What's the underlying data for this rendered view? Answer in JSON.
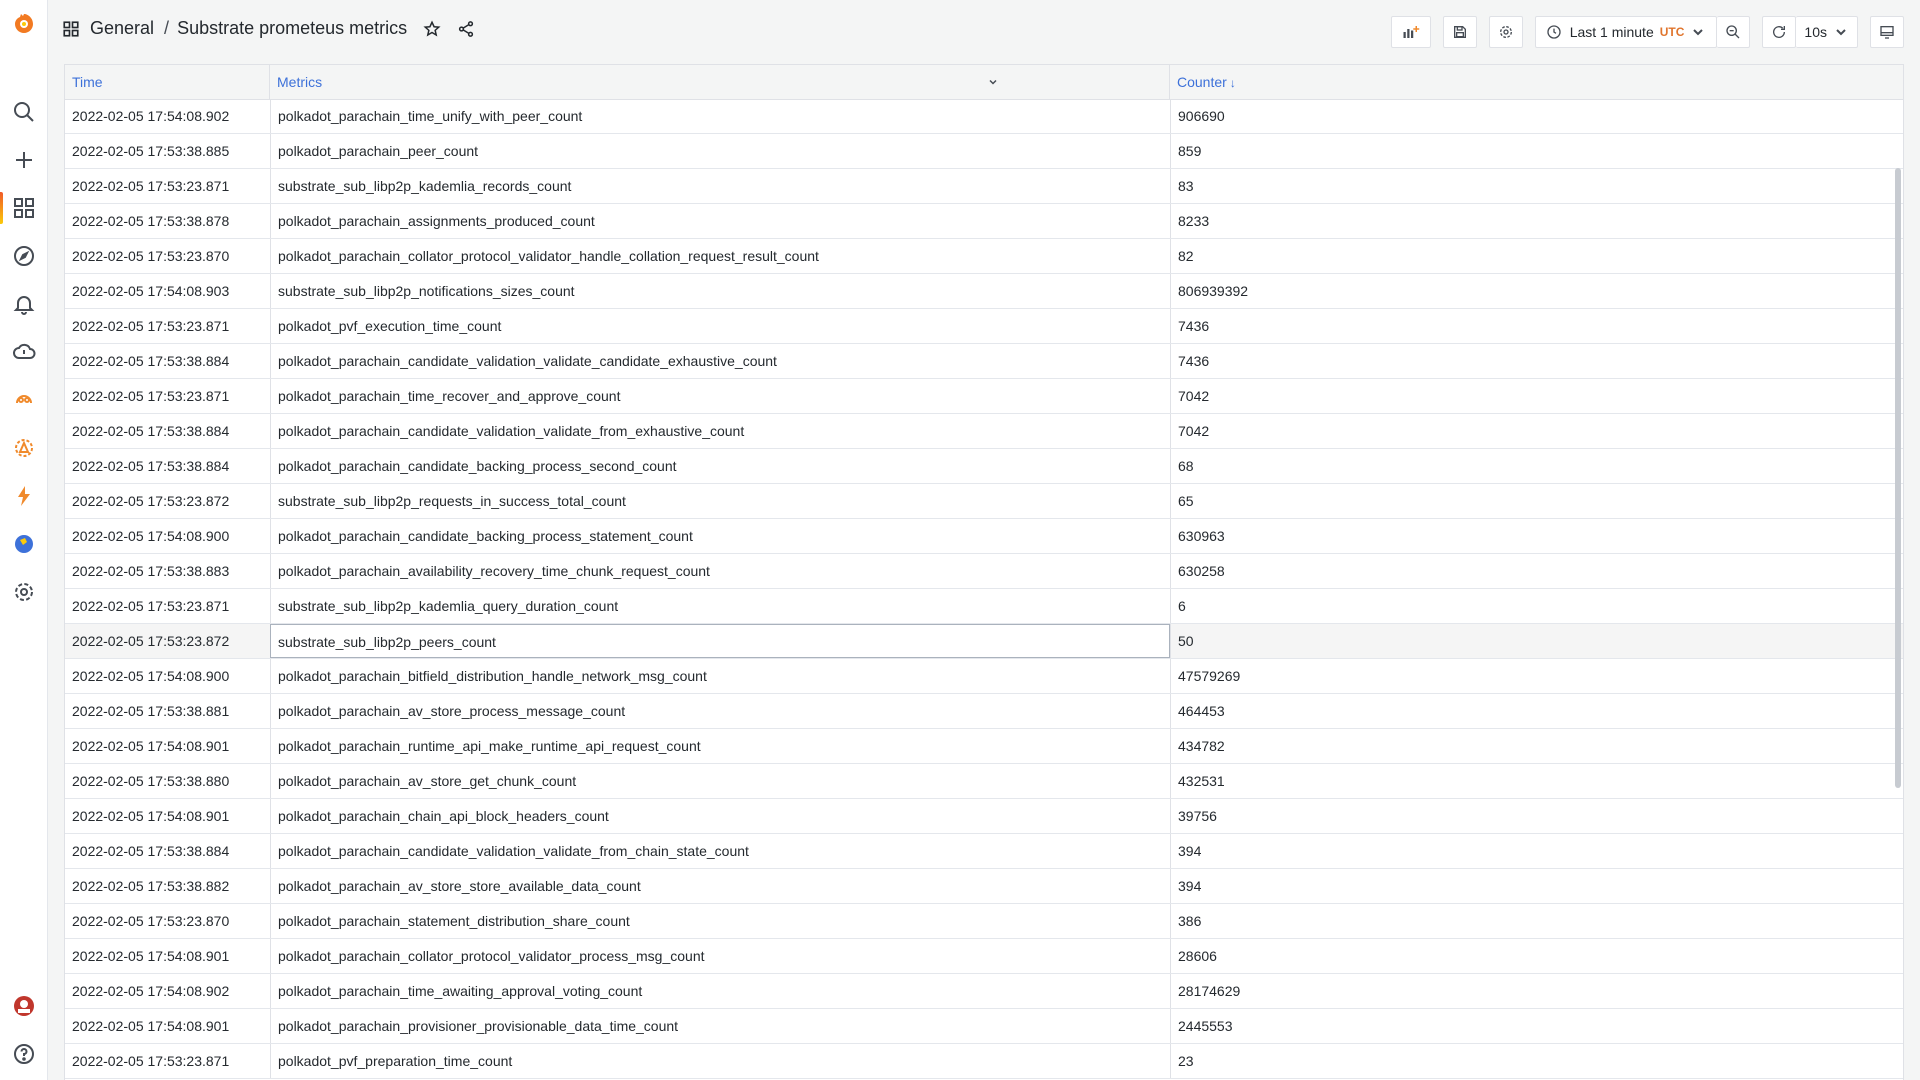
{
  "breadcrumb": {
    "folder": "General",
    "separator": "/",
    "title": "Substrate prometeus metrics"
  },
  "toolbar": {
    "time_range": "Last 1 minute",
    "timezone": "UTC",
    "refresh_interval": "10s"
  },
  "table": {
    "columns": [
      "Time",
      "Metrics",
      "Counter"
    ],
    "sort_column": "Counter",
    "sort_direction": "↓",
    "rows": [
      {
        "time": "2022-02-05 17:54:08.902",
        "metric": "polkadot_parachain_time_unify_with_peer_count",
        "counter": "906690"
      },
      {
        "time": "2022-02-05 17:53:38.885",
        "metric": "polkadot_parachain_peer_count",
        "counter": "859"
      },
      {
        "time": "2022-02-05 17:53:23.871",
        "metric": "substrate_sub_libp2p_kademlia_records_count",
        "counter": "83"
      },
      {
        "time": "2022-02-05 17:53:38.878",
        "metric": "polkadot_parachain_assignments_produced_count",
        "counter": "8233"
      },
      {
        "time": "2022-02-05 17:53:23.870",
        "metric": "polkadot_parachain_collator_protocol_validator_handle_collation_request_result_count",
        "counter": "82"
      },
      {
        "time": "2022-02-05 17:54:08.903",
        "metric": "substrate_sub_libp2p_notifications_sizes_count",
        "counter": "806939392"
      },
      {
        "time": "2022-02-05 17:53:23.871",
        "metric": "polkadot_pvf_execution_time_count",
        "counter": "7436"
      },
      {
        "time": "2022-02-05 17:53:38.884",
        "metric": "polkadot_parachain_candidate_validation_validate_candidate_exhaustive_count",
        "counter": "7436"
      },
      {
        "time": "2022-02-05 17:53:23.871",
        "metric": "polkadot_parachain_time_recover_and_approve_count",
        "counter": "7042"
      },
      {
        "time": "2022-02-05 17:53:38.884",
        "metric": "polkadot_parachain_candidate_validation_validate_from_exhaustive_count",
        "counter": "7042"
      },
      {
        "time": "2022-02-05 17:53:38.884",
        "metric": "polkadot_parachain_candidate_backing_process_second_count",
        "counter": "68"
      },
      {
        "time": "2022-02-05 17:53:23.872",
        "metric": "substrate_sub_libp2p_requests_in_success_total_count",
        "counter": "65"
      },
      {
        "time": "2022-02-05 17:54:08.900",
        "metric": "polkadot_parachain_candidate_backing_process_statement_count",
        "counter": "630963"
      },
      {
        "time": "2022-02-05 17:53:38.883",
        "metric": "polkadot_parachain_availability_recovery_time_chunk_request_count",
        "counter": "630258"
      },
      {
        "time": "2022-02-05 17:53:23.871",
        "metric": "substrate_sub_libp2p_kademlia_query_duration_count",
        "counter": "6"
      },
      {
        "time": "2022-02-05 17:53:23.872",
        "metric": "substrate_sub_libp2p_peers_count",
        "counter": "50"
      },
      {
        "time": "2022-02-05 17:54:08.900",
        "metric": "polkadot_parachain_bitfield_distribution_handle_network_msg_count",
        "counter": "47579269"
      },
      {
        "time": "2022-02-05 17:53:38.881",
        "metric": "polkadot_parachain_av_store_process_message_count",
        "counter": "464453"
      },
      {
        "time": "2022-02-05 17:54:08.901",
        "metric": "polkadot_parachain_runtime_api_make_runtime_api_request_count",
        "counter": "434782"
      },
      {
        "time": "2022-02-05 17:53:38.880",
        "metric": "polkadot_parachain_av_store_get_chunk_count",
        "counter": "432531"
      },
      {
        "time": "2022-02-05 17:54:08.901",
        "metric": "polkadot_parachain_chain_api_block_headers_count",
        "counter": "39756"
      },
      {
        "time": "2022-02-05 17:53:38.884",
        "metric": "polkadot_parachain_candidate_validation_validate_from_chain_state_count",
        "counter": "394"
      },
      {
        "time": "2022-02-05 17:53:38.882",
        "metric": "polkadot_parachain_av_store_store_available_data_count",
        "counter": "394"
      },
      {
        "time": "2022-02-05 17:53:23.870",
        "metric": "polkadot_parachain_statement_distribution_share_count",
        "counter": "386"
      },
      {
        "time": "2022-02-05 17:54:08.901",
        "metric": "polkadot_parachain_collator_protocol_validator_process_msg_count",
        "counter": "28606"
      },
      {
        "time": "2022-02-05 17:54:08.902",
        "metric": "polkadot_parachain_time_awaiting_approval_voting_count",
        "counter": "28174629"
      },
      {
        "time": "2022-02-05 17:54:08.901",
        "metric": "polkadot_parachain_provisioner_provisionable_data_time_count",
        "counter": "2445553"
      },
      {
        "time": "2022-02-05 17:53:23.871",
        "metric": "polkadot_pvf_preparation_time_count",
        "counter": "23"
      }
    ]
  }
}
